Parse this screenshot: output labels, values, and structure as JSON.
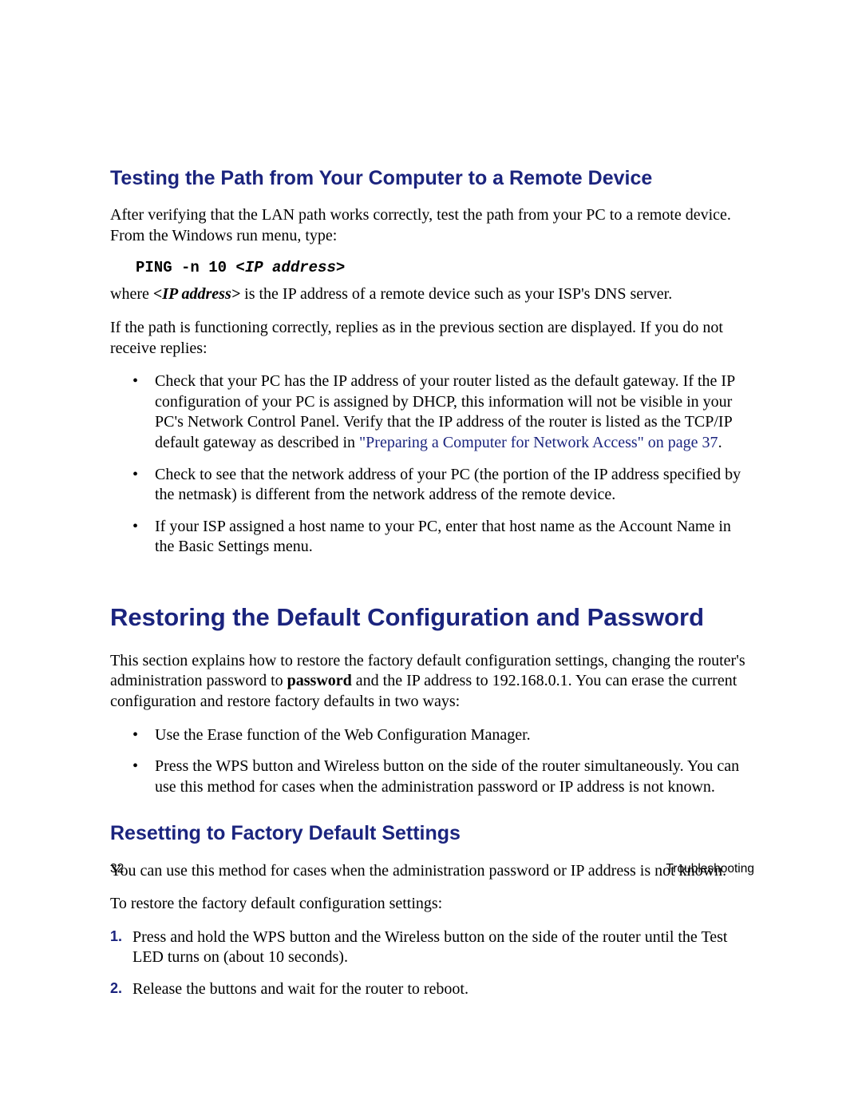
{
  "section1": {
    "heading": "Testing the Path from Your Computer to a Remote Device",
    "p1": "After verifying that the LAN path works correctly, test the path from your PC to a remote device. From the Windows run menu, type:",
    "cmd_prefix": "PING -n 10 <",
    "cmd_arg": "IP address",
    "cmd_suffix": ">",
    "p2_a": "where ",
    "p2_b": "<IP address>",
    "p2_c": " is the IP address of a remote device such as your ISP's DNS server.",
    "p3": "If the path is functioning correctly, replies as in the previous section are displayed. If you do not receive replies:",
    "b1_a": "Check that your PC has the IP address of your router listed as the default gateway. If the IP configuration of your PC is assigned by DHCP, this information will not be visible in your PC's Network Control Panel. Verify that the IP address of the router is listed as the TCP/IP default gateway as described in ",
    "b1_link": "\"Preparing a Computer for Network Access\" on page 37",
    "b1_b": ".",
    "b2": "Check to see that the network address of your PC (the portion of the IP address specified by the netmask) is different from the network address of the remote device.",
    "b3": "If your ISP assigned a host name to your PC, enter that host name as the Account Name in the Basic Settings menu."
  },
  "section2": {
    "heading": "Restoring the Default Configuration and Password",
    "p1_a": "This section explains how to restore the factory default configuration settings, changing the router's administration password to ",
    "p1_bold": "password",
    "p1_b": " and the IP address to 192.168.0.1. You can erase the current configuration and restore factory defaults in two ways:",
    "b1": "Use the Erase function of the Web Configuration Manager.",
    "b2": "Press the WPS button and Wireless button on the side of the router simultaneously. You can use this method for cases when the administration password or IP address is not known."
  },
  "section3": {
    "heading": "Resetting to Factory Default Settings",
    "p1": "You can use this method for cases when the administration password or IP address is not known.",
    "p2": "To restore the factory default configuration settings:",
    "s1": "Press and hold the WPS button and the Wireless button on the side of the router until the Test LED turns on (about 10 seconds).",
    "s2": "Release the buttons and wait for the router to reboot."
  },
  "footer": {
    "page": "32",
    "section": "Troubleshooting"
  }
}
